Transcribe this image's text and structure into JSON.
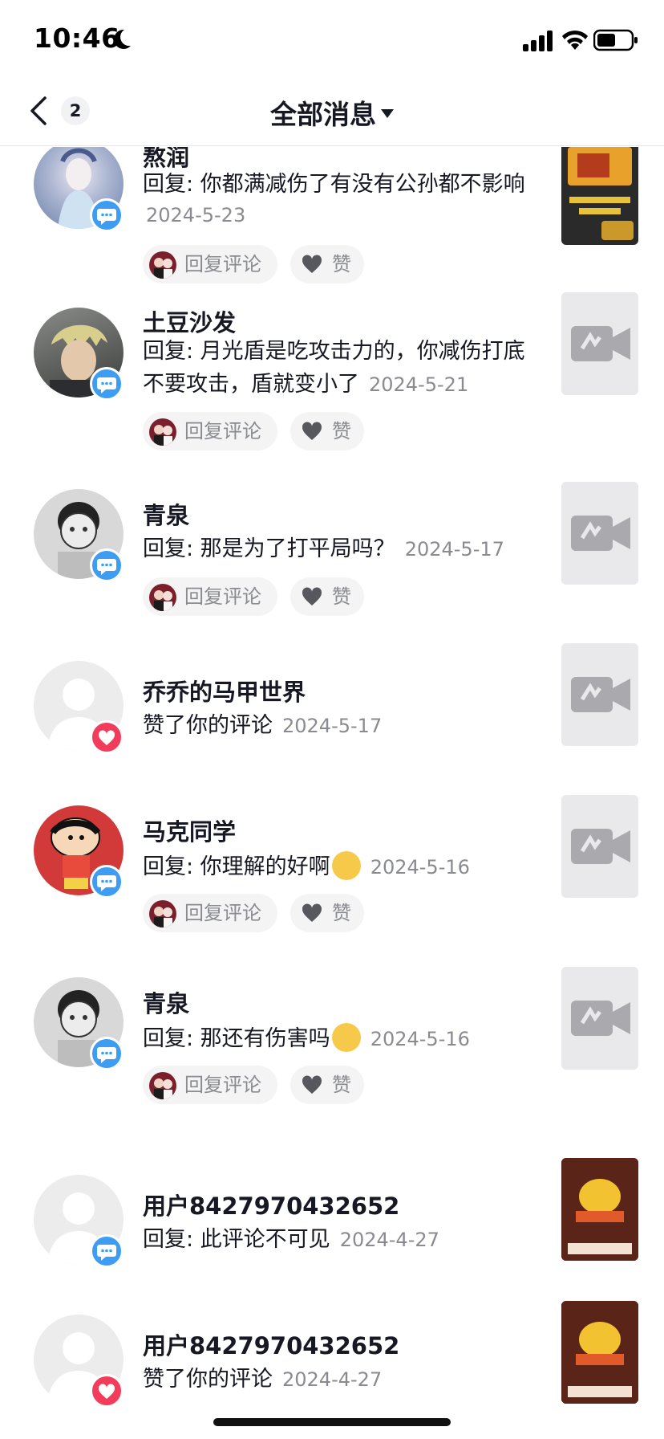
{
  "status_bar": {
    "time": "10:46"
  },
  "nav": {
    "count": "2",
    "title": "全部消息"
  },
  "actions": {
    "reply_label": "回复评论",
    "like_label": "赞"
  },
  "colors": {
    "comment_badge": "#3c9df2",
    "like_badge": "#f23c5c",
    "accent_text": "#161823",
    "muted": "#8a8b91"
  },
  "items": [
    {
      "name": "熬润",
      "text": "回复: 你都满减伤了有没有公孙都不影响",
      "date": "2024-5-23",
      "badge": "comment-icon",
      "thumb": "game-image"
    },
    {
      "name": "土豆沙发",
      "text": "回复: 月光盾是吃攻击力的，你减伤打底不要攻击，盾就变小了",
      "date": "2024-5-21",
      "badge": "comment-icon",
      "thumb": "video-placeholder-icon"
    },
    {
      "name": "青泉",
      "text": "回复: 那是为了打平局吗？",
      "date": "2024-5-17",
      "badge": "comment-icon",
      "thumb": "video-placeholder-icon"
    },
    {
      "name": "乔乔的马甲世界",
      "text": "赞了你的评论",
      "date": "2024-5-17",
      "badge": "heart-icon",
      "thumb": "video-placeholder-icon"
    },
    {
      "name": "马克同学",
      "text": "回复: 你理解的好啊",
      "date": "2024-5-16",
      "badge": "comment-icon",
      "thumb": "video-placeholder-icon"
    },
    {
      "name": "青泉",
      "text": "回复: 那还有伤害吗",
      "date": "2024-5-16",
      "badge": "comment-icon",
      "thumb": "video-placeholder-icon"
    },
    {
      "name": "用户8427970432652",
      "text": "回复: 此评论不可见",
      "date": "2024-4-27",
      "badge": "comment-icon",
      "thumb": "game-image"
    },
    {
      "name": "用户8427970432652",
      "text": "赞了你的评论",
      "date": "2024-4-27",
      "badge": "heart-icon",
      "thumb": "game-image"
    }
  ]
}
